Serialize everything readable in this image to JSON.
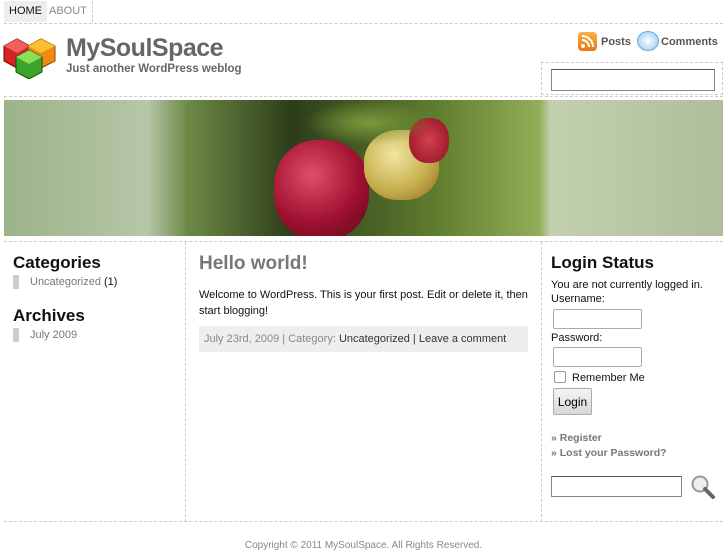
{
  "nav": {
    "items": [
      "HOME",
      "ABOUT"
    ]
  },
  "header": {
    "title": "MySoulSpace",
    "tagline": "Just another WordPress weblog",
    "feeds": {
      "posts": "Posts",
      "comments": "Comments"
    }
  },
  "colors": {
    "title": "#666666",
    "meta_bg": "#eeeeee"
  },
  "left_sidebar": {
    "categories": {
      "title": "Categories",
      "items": [
        {
          "label": "Uncategorized",
          "count": "(1)"
        }
      ]
    },
    "archives": {
      "title": "Archives",
      "items": [
        {
          "label": "July 2009"
        }
      ]
    }
  },
  "post": {
    "title": "Hello world!",
    "body": "Welcome to WordPress. This is your first post. Edit or delete it, then start blogging!",
    "date": "July 23rd, 2009 | Category: ",
    "category": "Uncategorized",
    "sep": " | ",
    "comment": "Leave a comment"
  },
  "login": {
    "title": "Login Status",
    "status": "You are not currently logged in.",
    "username_label": "Username:",
    "password_label": "Password:",
    "remember": "Remember Me",
    "button": "Login",
    "register": "» Register",
    "lost": "» Lost your Password?"
  },
  "footer": {
    "text": "Copyright © 2011 MySoulSpace. All Rights Reserved."
  }
}
